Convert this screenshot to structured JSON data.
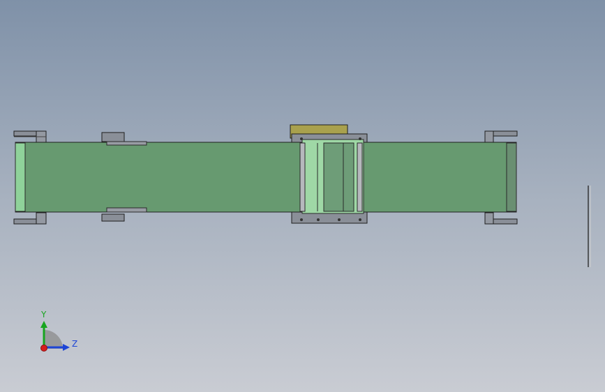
{
  "viewport": {
    "colors": {
      "bg_top": "#7f91a8",
      "bg_bottom": "#c9ccd3",
      "belt": "#679a70",
      "roller": "#8fd29a",
      "metal": "#8a8f98",
      "box": "#a9a14d"
    }
  },
  "triad": {
    "y_label": "Y",
    "z_label": "Z",
    "icons": [
      "y-axis-arrow-icon",
      "z-axis-arrow-icon",
      "x-axis-dot-icon"
    ]
  },
  "scroll": {
    "icon": "vertical-scrollbar-icon"
  }
}
